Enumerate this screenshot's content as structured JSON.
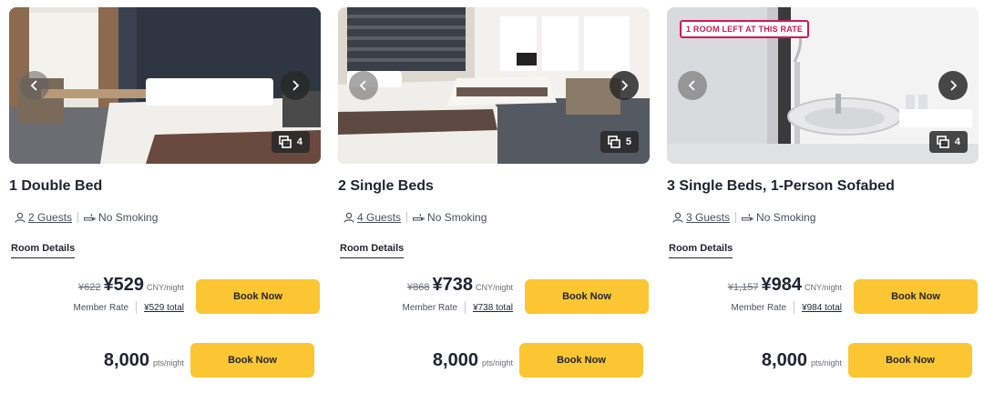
{
  "rooms": [
    {
      "photo_count": "4",
      "badge": "",
      "title": "1 Double Bed",
      "guests": "2 Guests",
      "smoking": "No Smoking",
      "details_label": "Room Details",
      "old_price": "¥622",
      "price": "¥529",
      "price_unit": "CNY/night",
      "rate_label": "Member Rate",
      "total": "¥529 total",
      "book_label": "Book Now",
      "points": "8,000",
      "points_unit": "pts/night",
      "book_points_label": "Book Now"
    },
    {
      "photo_count": "5",
      "badge": "",
      "title": "2 Single Beds",
      "guests": "4 Guests",
      "smoking": "No Smoking",
      "details_label": "Room Details",
      "old_price": "¥868",
      "price": "¥738",
      "price_unit": "CNY/night",
      "rate_label": "Member Rate",
      "total": "¥738 total",
      "book_label": "Book Now",
      "points": "8,000",
      "points_unit": "pts/night",
      "book_points_label": "Book Now"
    },
    {
      "photo_count": "4",
      "badge": "1 ROOM LEFT AT THIS RATE",
      "title": "3 Single Beds, 1-Person Sofabed",
      "guests": "3 Guests",
      "smoking": "No Smoking",
      "details_label": "Room Details",
      "old_price": "¥1,157",
      "price": "¥984",
      "price_unit": "CNY/night",
      "rate_label": "Member Rate",
      "total": "¥984 total",
      "book_label": "Book Now",
      "points": "8,000",
      "points_unit": "pts/night",
      "book_points_label": "Book Now"
    }
  ],
  "colors": {
    "accent_button": "#fcc632",
    "badge_red": "#d01a56",
    "text_dark": "#1f2433"
  }
}
